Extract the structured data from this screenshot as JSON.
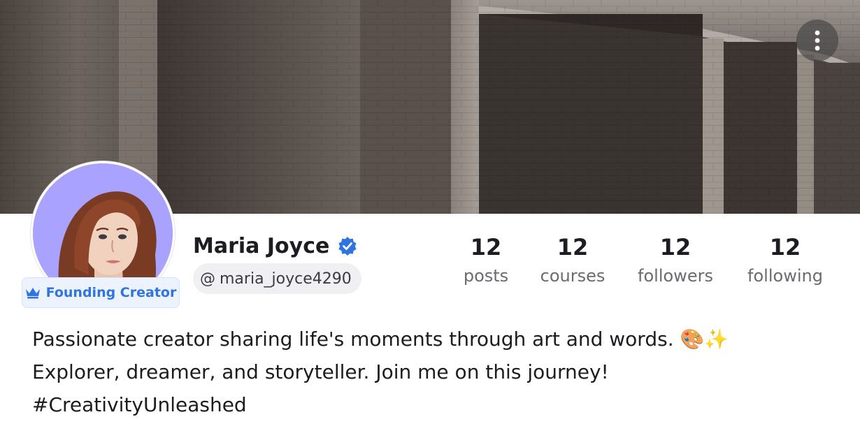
{
  "header": {
    "menu_icon": "more-vertical-icon"
  },
  "profile": {
    "name": "Maria Joyce",
    "verified_icon": "verified-badge-icon",
    "handle_prefix": "@",
    "handle": "maria_joyce4290",
    "badge_icon": "crown-icon",
    "badge_label": "Founding Creator"
  },
  "stats": [
    {
      "value": "12",
      "label": "posts"
    },
    {
      "value": "12",
      "label": "courses"
    },
    {
      "value": "12",
      "label": "followers"
    },
    {
      "value": "12",
      "label": "following"
    }
  ],
  "bio": {
    "line1": "Passionate creator sharing life's moments through art and words. 🎨✨",
    "line2": "Explorer, dreamer, and storyteller. Join me on this journey!",
    "line3": "#CreativityUnleashed"
  },
  "colors": {
    "accent": "#2f74e0",
    "avatar_bg": "#a9a2ff",
    "badge_bg": "#ecf3ff"
  }
}
